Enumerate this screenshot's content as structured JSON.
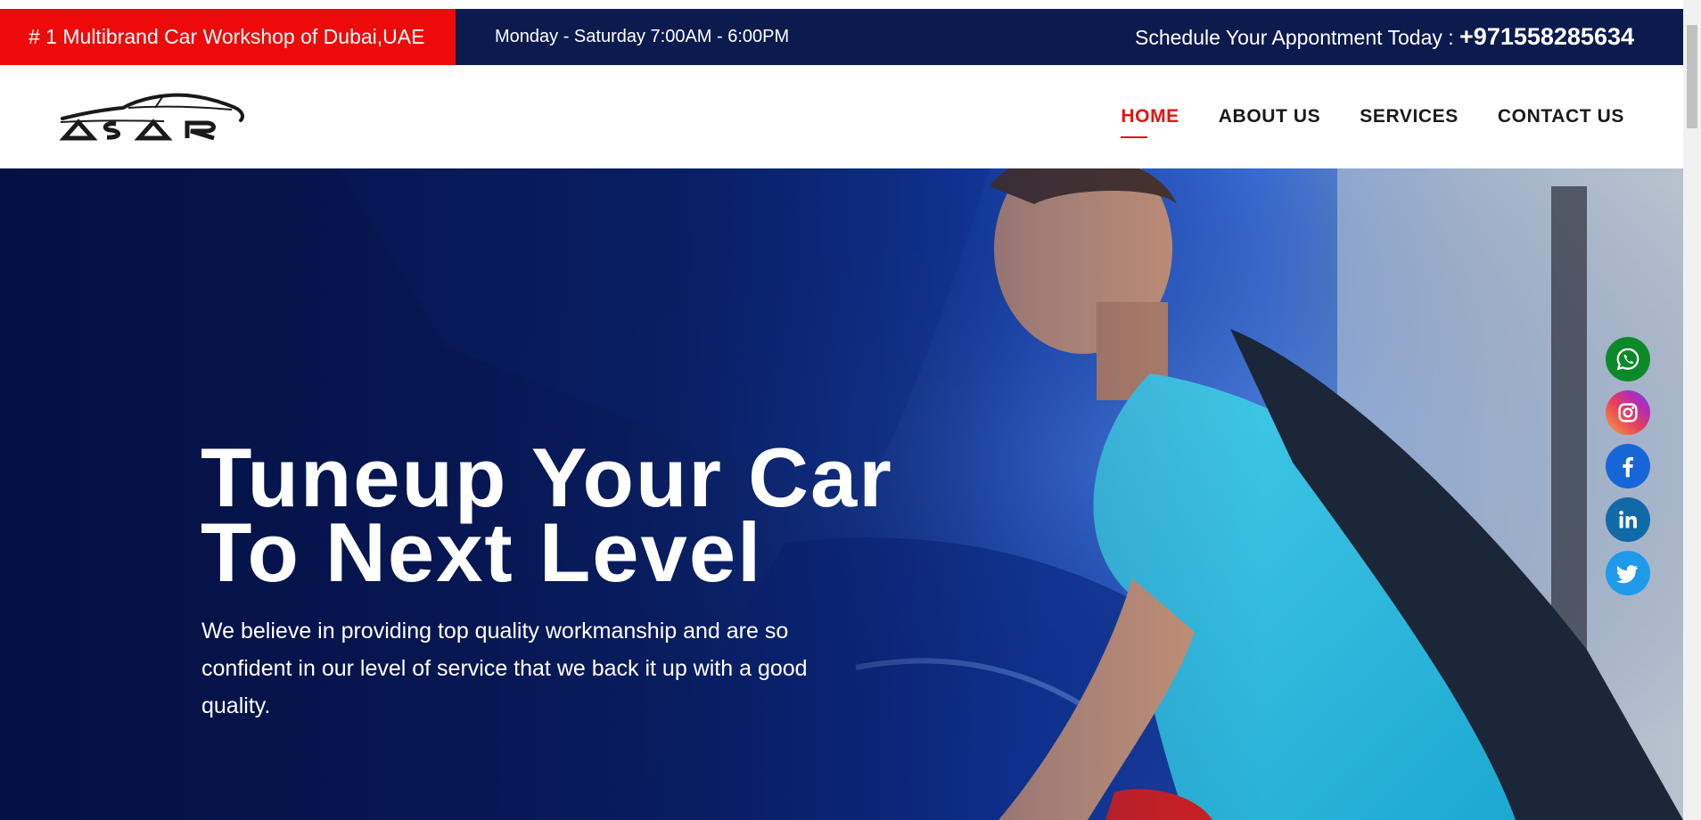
{
  "topbar": {
    "tagline": "# 1 Multibrand Car Workshop of Dubai,UAE",
    "hours": "Monday - Saturday 7:00AM - 6:00PM",
    "schedule_label": "Schedule Your Appontment Today : ",
    "phone": "+971558285634"
  },
  "header": {
    "logo_text": "ASAR",
    "nav": [
      {
        "label": "HOME",
        "active": true
      },
      {
        "label": "ABOUT US",
        "active": false
      },
      {
        "label": "SERVICES",
        "active": false
      },
      {
        "label": "CONTACT US",
        "active": false
      }
    ]
  },
  "hero": {
    "title_line1": "Tuneup Your Car",
    "title_line2": "To Next Level",
    "description": "We believe in providing top quality workmanship and are so confident in our level of service that we back it up with a good quality."
  },
  "social": [
    {
      "name": "whatsapp-icon",
      "color": "#0c8a2a"
    },
    {
      "name": "instagram-icon",
      "color": "#e7405a"
    },
    {
      "name": "facebook-icon",
      "color": "#1766d8"
    },
    {
      "name": "linkedin-icon",
      "color": "#116aa8"
    },
    {
      "name": "twitter-icon",
      "color": "#1d9bea"
    }
  ],
  "colors": {
    "brand_red": "#ee0a0a",
    "navy": "#0c1b4d",
    "active_nav": "#e31414"
  }
}
